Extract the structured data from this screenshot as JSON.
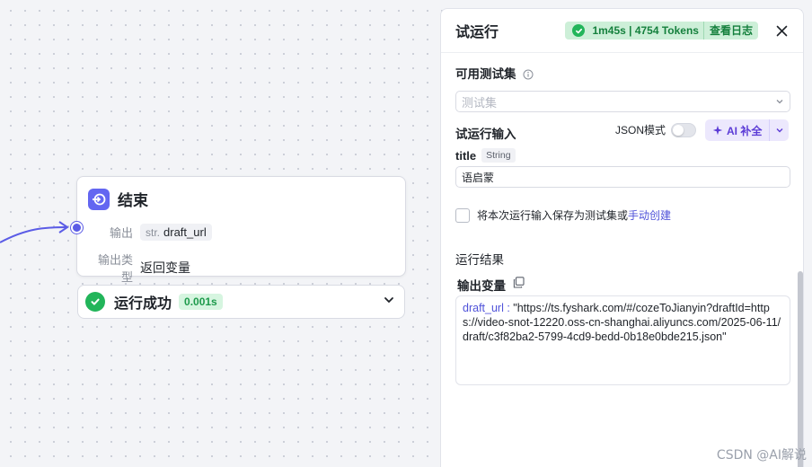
{
  "node": {
    "title": "结束",
    "output_label": "输出",
    "output_var_type": "str.",
    "output_var_name": "draft_url",
    "output_type_label": "输出类型",
    "output_type_value": "返回变量"
  },
  "status": {
    "text": "运行成功",
    "time": "0.001s"
  },
  "panel": {
    "title": "试运行",
    "run_stats": "1m45s | 4754 Tokens",
    "view_log": "查看日志",
    "test_set_label": "可用测试集",
    "test_set_placeholder": "测试集",
    "run_input_label": "试运行输入",
    "json_mode_label": "JSON模式",
    "ai_fill_label": "AI 补全",
    "field_name": "title",
    "field_type": "String",
    "field_value": "语启蒙",
    "save_text": "将本次运行输入保存为测试集或",
    "save_link": "手动创建",
    "result_label": "运行结果",
    "output_var_label": "输出变量",
    "output_key": "draft_url :",
    "output_value": " \"https://ts.fyshark.com/#/cozeToJianyin?draftId=https://video-snot-12220.oss-cn-shanghai.aliyuncs.com/2025-06-11/draft/c3f82ba2-5799-4cd9-bedd-0b18e0bde215.json\""
  },
  "watermark": "CSDN @AI解说",
  "colors": {
    "accent": "#5b5ce6",
    "success": "#22b55a",
    "ai_purple": "#5b3bd6"
  }
}
